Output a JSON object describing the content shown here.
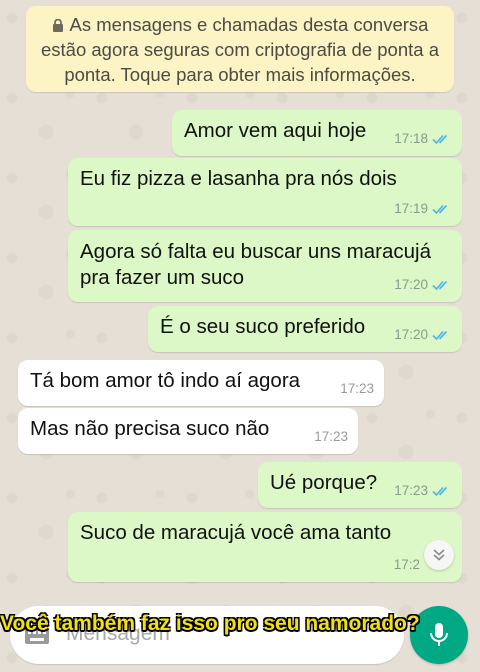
{
  "notice": {
    "line1": "As mensagens e chamadas desta conversa",
    "line2": "estão agora seguras com criptografia de ponta a",
    "line3": "ponta. Toque para obter mais informações."
  },
  "messages": [
    {
      "dir": "out",
      "text": "Amor vem aqui hoje",
      "time": "17:18",
      "status": "read"
    },
    {
      "dir": "out",
      "text": "Eu fiz pizza e lasanha pra nós dois",
      "time": "17:19",
      "status": "read"
    },
    {
      "dir": "out",
      "text_lines": [
        "Agora só falta eu buscar uns maracujá",
        "pra fazer um suco"
      ],
      "time": "17:20",
      "status": "read"
    },
    {
      "dir": "out",
      "text": "É o seu suco preferido",
      "time": "17:20",
      "status": "read"
    },
    {
      "dir": "in",
      "text": "Tá bom amor tô indo aí agora",
      "time": "17:23"
    },
    {
      "dir": "in",
      "text": "Mas não precisa suco não",
      "time": "17:23"
    },
    {
      "dir": "out",
      "text": "Ué porque?",
      "time": "17:23",
      "status": "read"
    },
    {
      "dir": "out",
      "text": "Suco de maracujá você ama tanto",
      "time": "17:2",
      "status": "read"
    }
  ],
  "composer": {
    "placeholder": "Mensagem"
  },
  "caption": "Você também faz isso pro seu namorado?",
  "colors": {
    "outgoing_bubble": "#dcf8c6",
    "incoming_bubble": "#ffffff",
    "notice_bg": "#fdf4c5",
    "read_tick": "#4fb6ec",
    "accent": "#00a884",
    "caption": "#f4e012"
  },
  "icons": [
    "lock-icon",
    "double-check-icon",
    "chevron-down-double-icon",
    "keyboard-icon",
    "mic-icon"
  ]
}
